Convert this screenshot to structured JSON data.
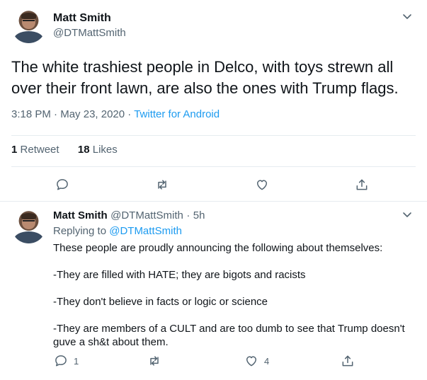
{
  "main_tweet": {
    "name": "Matt Smith",
    "handle": "@DTMattSmith",
    "text": "The white trashiest people in Delco,  with toys  strewn all over their front lawn, are also the ones with Trump flags.",
    "time": "3:18 PM",
    "date": "May 23, 2020",
    "source": "Twitter for Android",
    "separator": "·",
    "retweets_count": "1",
    "retweets_label": "Retweet",
    "likes_count": "18",
    "likes_label": "Likes"
  },
  "reply_tweet": {
    "name": "Matt Smith",
    "handle": "@DTMattSmith",
    "age": "5h",
    "separator": "·",
    "replying_label": "Replying to",
    "replying_to": "@DTMattSmith",
    "paragraphs": [
      "These people are proudly announcing the following about themselves:",
      "-They are filled with HATE; they are bigots and racists",
      "-They don't believe in facts or logic or science",
      "-They are members of a CULT and are too dumb to see that Trump doesn't guve a sh&t about them."
    ],
    "reply_count": "1",
    "like_count": "4"
  },
  "icons": {
    "menu": "chevron-down-icon",
    "reply": "comment-icon",
    "retweet": "retweet-icon",
    "like": "heart-icon",
    "share": "share-icon"
  },
  "colors": {
    "link": "#1d9bf0",
    "secondary_text": "#536471",
    "divider": "#e6ecf0"
  }
}
